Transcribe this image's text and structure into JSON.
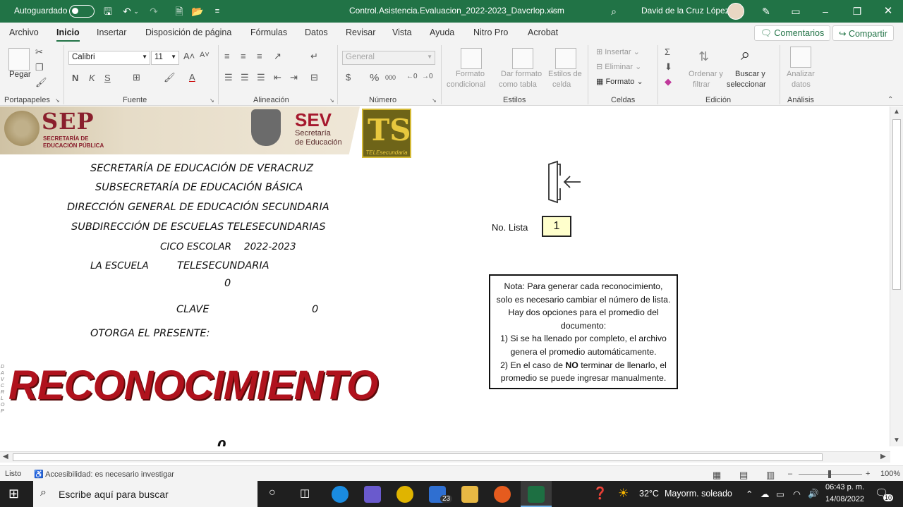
{
  "titlebar": {
    "autosave_label": "Autoguardado",
    "filename": "Control.Asistencia.Evaluacion_2022-2023_Davcrlop.xlsm",
    "user": "David de la Cruz López"
  },
  "tabs": [
    "Archivo",
    "Inicio",
    "Insertar",
    "Disposición de página",
    "Fórmulas",
    "Datos",
    "Revisar",
    "Vista",
    "Ayuda",
    "Nitro Pro",
    "Acrobat"
  ],
  "tab_actions": {
    "comments": "Comentarios",
    "share": "Compartir"
  },
  "ribbon": {
    "portapapeles": {
      "label": "Portapapeles",
      "paste": "Pegar"
    },
    "fuente": {
      "label": "Fuente",
      "font": "Calibri",
      "size": "11",
      "bold": "N",
      "italic": "K",
      "underline": "S"
    },
    "alineacion": {
      "label": "Alineación"
    },
    "numero": {
      "label": "Número",
      "format": "General",
      "currency": "$",
      "percent": "%",
      "thousands": "000"
    },
    "estilos": {
      "label": "Estilos",
      "cond_format": [
        "Formato",
        "condicional"
      ],
      "table_format": [
        "Dar formato",
        "como tabla"
      ],
      "cell_styles": [
        "Estilos de",
        "celda"
      ]
    },
    "celdas": {
      "label": "Celdas",
      "insert": "Insertar",
      "delete": "Eliminar",
      "format": "Formato"
    },
    "edicion": {
      "label": "Edición",
      "sort": [
        "Ordenar y",
        "filtrar"
      ],
      "find": [
        "Buscar y",
        "seleccionar"
      ]
    },
    "analisis": {
      "label": "Análisis",
      "analyze": [
        "Analizar",
        "datos"
      ]
    }
  },
  "sheet": {
    "logos": {
      "sep": "SEP",
      "sep_sub": [
        "SECRETARÍA DE",
        "EDUCACIÓN PÚBLICA"
      ],
      "sev": "SEV",
      "sev_sub": [
        "Secretaría",
        "de Educación"
      ],
      "ts": "TS",
      "ts_sub": "TELEsecundaria"
    },
    "header_lines": [
      "SECRETARÍA DE EDUCACIÓN DE VERACRUZ",
      "SUBSECRETARÍA DE EDUCACIÓN BÁSICA",
      "DIRECCIÓN GENERAL DE EDUCACIÓN SECUNDARIA",
      "SUBDIRECCIÓN DE ESCUELAS TELESECUNDARIAS"
    ],
    "ciclo_label": "CICO ESCOLAR",
    "ciclo_value": "2022-2023",
    "escuela_label": "LA ESCUELA",
    "escuela_value": "TELESECUNDARIA",
    "escuela_num": "0",
    "clave_label": "CLAVE",
    "clave_value": "0",
    "otorga": "OTORGA EL PRESENTE:",
    "title": "RECONOCIMIENTO",
    "vertical_text": "DAVCRLOP",
    "lista_label": "No. Lista",
    "lista_value": "1",
    "note": {
      "l1": "Nota: Para generar cada reconocimiento,",
      "l2": "solo es necesario cambiar el número de lista.",
      "l3": "Hay dos opciones para el promedio del",
      "l4": "documento:",
      "l5": "1) Si se ha llenado por completo, el archivo",
      "l6": "genera el promedio automáticamente.",
      "l7a": "2) En el caso de ",
      "l7b": "NO",
      "l7c": " terminar de llenarlo, el",
      "l8": "promedio se puede ingresar manualmente."
    },
    "partial_bottom": "0"
  },
  "status": {
    "ready": "Listo",
    "accessibility": "Accesibilidad: es necesario investigar",
    "zoom": "100%"
  },
  "taskbar": {
    "search_placeholder": "Escribe aquí para buscar",
    "badge": "23",
    "temp": "32°C",
    "weather": "Mayorm. soleado",
    "time": "06:43 p. m.",
    "date": "14/08/2022",
    "notif": "10"
  }
}
